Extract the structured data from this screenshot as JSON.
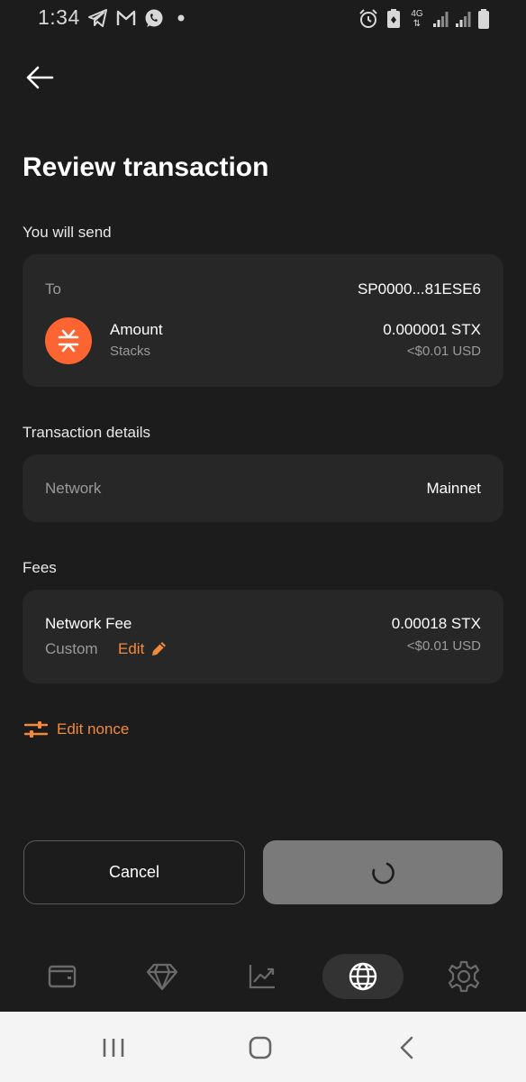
{
  "status_bar": {
    "time": "1:34",
    "network_type": "4G",
    "icons": [
      "telegram-icon",
      "gmail-icon",
      "viber-icon",
      "dot-icon",
      "alarm-icon",
      "battery-saver-icon",
      "signal-icon",
      "signal-icon",
      "battery-icon"
    ]
  },
  "header": {
    "back_icon": "arrow-left-icon",
    "title": "Review transaction"
  },
  "send_section": {
    "label": "You will send",
    "to_label": "To",
    "to_address": "SP0000...81ESE6",
    "asset_icon": "stacks-logo-icon",
    "amount_label": "Amount",
    "asset_name": "Stacks",
    "amount_value": "0.000001 STX",
    "amount_fiat": "<$0.01 USD"
  },
  "details_section": {
    "label": "Transaction details",
    "network_label": "Network",
    "network_value": "Mainnet"
  },
  "fees_section": {
    "label": "Fees",
    "fee_label": "Network Fee",
    "fee_type": "Custom",
    "edit_label": "Edit",
    "fee_value": "0.00018 STX",
    "fee_fiat": "<$0.01 USD"
  },
  "edit_nonce": {
    "label": "Edit nonce",
    "icon": "sliders-icon"
  },
  "actions": {
    "cancel_label": "Cancel",
    "confirm_state": "loading"
  },
  "tab_bar": {
    "tabs": [
      {
        "icon": "wallet-icon",
        "active": false
      },
      {
        "icon": "diamond-icon",
        "active": false
      },
      {
        "icon": "chart-icon",
        "active": false
      },
      {
        "icon": "globe-icon",
        "active": true
      },
      {
        "icon": "gear-icon",
        "active": false
      }
    ]
  },
  "colors": {
    "background": "#1c1c1c",
    "card": "#272727",
    "accent": "#f28a3c",
    "stacks_brand": "#fc6432",
    "confirm_disabled": "#7a7a7a"
  }
}
